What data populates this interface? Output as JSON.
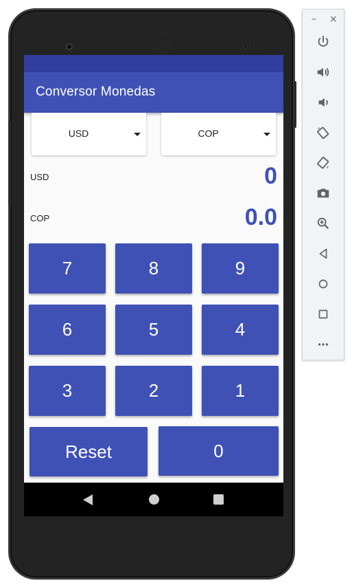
{
  "app": {
    "title": "Conversor Monedas"
  },
  "converter": {
    "from_currency": "USD",
    "to_currency": "COP",
    "from_label": "USD",
    "from_value": "0",
    "to_label": "COP",
    "to_value": "0.0"
  },
  "keypad": {
    "rows": [
      [
        "7",
        "8",
        "9"
      ],
      [
        "6",
        "5",
        "4"
      ],
      [
        "3",
        "2",
        "1"
      ]
    ],
    "reset_label": "Reset",
    "zero_label": "0"
  },
  "colors": {
    "primary": "#3f51b5",
    "primary_dark": "#303f9f",
    "accent_text": "#3f51b5"
  },
  "emulator_toolbar": {
    "window_controls": [
      "–",
      "×"
    ],
    "icons": [
      "power-icon",
      "volume-up-icon",
      "volume-down-icon",
      "rotate-left-icon",
      "rotate-right-icon",
      "camera-icon",
      "zoom-icon",
      "back-icon",
      "home-icon",
      "overview-icon",
      "more-icon"
    ]
  }
}
